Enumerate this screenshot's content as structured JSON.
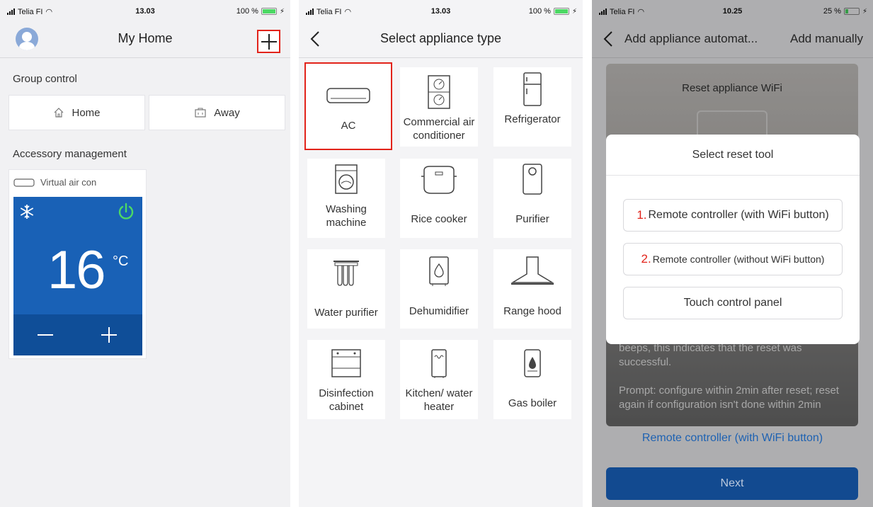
{
  "screens": [
    {
      "status": {
        "carrier": "Telia FI",
        "time": "13.03",
        "battery": "100 %",
        "battery_level": 1.0
      },
      "nav": {
        "title": "My Home"
      },
      "group_control": {
        "label": "Group control",
        "buttons": [
          {
            "label": "Home"
          },
          {
            "label": "Away"
          }
        ]
      },
      "accessory": {
        "label": "Accessory management",
        "device_name": "Virtual air con",
        "temperature": "16",
        "unit": "°C"
      }
    },
    {
      "status": {
        "carrier": "Telia FI",
        "time": "13.03",
        "battery": "100 %",
        "battery_level": 1.0
      },
      "nav": {
        "title": "Select appliance type"
      },
      "appliances": [
        {
          "label": "AC",
          "icon": "ac-unit-icon",
          "selected": true
        },
        {
          "label": "Commercial air conditioner",
          "icon": "commercial-ac-icon"
        },
        {
          "label": "Refrigerator",
          "icon": "refrigerator-icon"
        },
        {
          "label": "Washing machine",
          "icon": "washing-machine-icon"
        },
        {
          "label": "Rice cooker",
          "icon": "rice-cooker-icon"
        },
        {
          "label": "Purifier",
          "icon": "purifier-icon"
        },
        {
          "label": "Water purifier",
          "icon": "water-purifier-icon"
        },
        {
          "label": "Dehumidifier",
          "icon": "dehumidifier-icon"
        },
        {
          "label": "Range hood",
          "icon": "range-hood-icon"
        },
        {
          "label": "Disinfection cabinet",
          "icon": "disinfection-cabinet-icon"
        },
        {
          "label": "Kitchen/ water heater",
          "icon": "water-heater-icon"
        },
        {
          "label": "Gas boiler",
          "icon": "gas-boiler-icon"
        }
      ]
    },
    {
      "status": {
        "carrier": "Telia FI",
        "time": "10.25",
        "battery": "25 %",
        "battery_level": 0.25
      },
      "nav": {
        "title": "Add appliance automat...",
        "right": "Add manually"
      },
      "background": {
        "heading": "Reset appliance WiFi",
        "desc_1": "beeps, this indicates that the reset was successful.",
        "desc_2": "Prompt: configure within 2min after reset; reset again if configuration isn't done within 2min"
      },
      "modal": {
        "title": "Select reset tool",
        "options": [
          {
            "num": "1.",
            "label": "Remote controller (with WiFi button)"
          },
          {
            "num": "2.",
            "label": "Remote controller (without WiFi button)"
          },
          {
            "num": "",
            "label": "Touch control panel"
          }
        ]
      },
      "selected_tool": "Remote controller (with WiFi button)",
      "next_label": "Next"
    }
  ],
  "colors": {
    "accent_red": "#e2231a",
    "ac_blue": "#1961b6",
    "ac_dark_blue": "#0f4e98",
    "link_blue": "#1e62b2",
    "next_blue": "#124a90",
    "power_green": "#4cd964"
  }
}
